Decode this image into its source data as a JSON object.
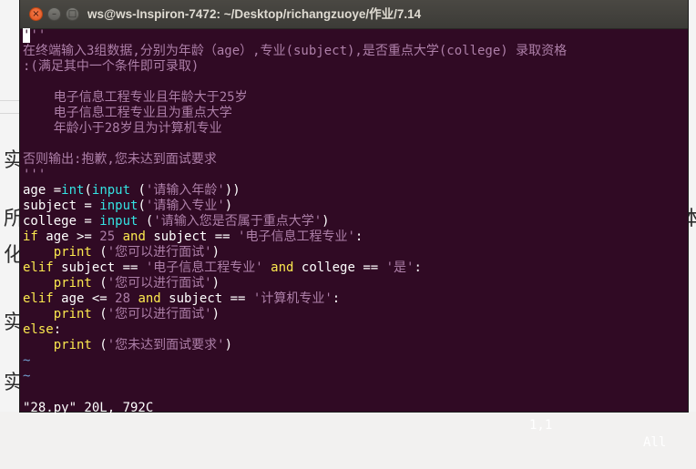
{
  "window": {
    "title": "ws@ws-Inspiron-7472: ~/Desktop/richangzuoye/作业/7.14",
    "buttons": {
      "close": "×",
      "minimize": "–",
      "maximize": "□"
    }
  },
  "background_text": [
    "实",
    "所",
    "化",
    "实",
    "实"
  ],
  "background_right_text": "本",
  "editor": {
    "lines": [
      [
        [
          "str",
          "'''"
        ]
      ],
      [
        [
          "str",
          "在终端输入3组数据,分别为年龄（age）,专业(subject),是否重点大学(college) 录取资格"
        ]
      ],
      [
        [
          "str",
          ":(满足其中一个条件即可录取)"
        ]
      ],
      [
        [
          "str",
          ""
        ]
      ],
      [
        [
          "str",
          "    电子信息工程专业且年龄大于25岁"
        ]
      ],
      [
        [
          "str",
          "    电子信息工程专业且为重点大学"
        ]
      ],
      [
        [
          "str",
          "    年龄小于28岁且为计算机专业"
        ]
      ],
      [
        [
          "str",
          ""
        ]
      ],
      [
        [
          "str",
          "否则输出:抱歉,您未达到面试要求"
        ]
      ],
      [
        [
          "str",
          "'''"
        ]
      ],
      [
        [
          "txt",
          "age ="
        ],
        [
          "bi",
          "int"
        ],
        [
          "txt",
          "("
        ],
        [
          "bi",
          "input"
        ],
        [
          "txt",
          " ("
        ],
        [
          "str",
          "'请输入年龄'"
        ],
        [
          "txt",
          "))"
        ]
      ],
      [
        [
          "txt",
          "subject = "
        ],
        [
          "bi",
          "input"
        ],
        [
          "txt",
          "("
        ],
        [
          "str",
          "'请输入专业'"
        ],
        [
          "txt",
          ")"
        ]
      ],
      [
        [
          "txt",
          "college = "
        ],
        [
          "bi",
          "input"
        ],
        [
          "txt",
          " ("
        ],
        [
          "str",
          "'请输入您是否属于重点大学'"
        ],
        [
          "txt",
          ")"
        ]
      ],
      [
        [
          "kw",
          "if"
        ],
        [
          "txt",
          " age >= "
        ],
        [
          "num",
          "25"
        ],
        [
          "txt",
          " "
        ],
        [
          "kw",
          "and"
        ],
        [
          "txt",
          " subject == "
        ],
        [
          "str",
          "'电子信息工程专业'"
        ],
        [
          "txt",
          ":"
        ]
      ],
      [
        [
          "txt",
          "    "
        ],
        [
          "kw",
          "print"
        ],
        [
          "txt",
          " ("
        ],
        [
          "str",
          "'您可以进行面试'"
        ],
        [
          "txt",
          ")"
        ]
      ],
      [
        [
          "kw",
          "elif"
        ],
        [
          "txt",
          " subject == "
        ],
        [
          "str",
          "'电子信息工程专业'"
        ],
        [
          "txt",
          " "
        ],
        [
          "kw",
          "and"
        ],
        [
          "txt",
          " college == "
        ],
        [
          "str",
          "'是'"
        ],
        [
          "txt",
          ":"
        ]
      ],
      [
        [
          "txt",
          "    "
        ],
        [
          "kw",
          "print"
        ],
        [
          "txt",
          " ("
        ],
        [
          "str",
          "'您可以进行面试'"
        ],
        [
          "txt",
          ")"
        ]
      ],
      [
        [
          "kw",
          "elif"
        ],
        [
          "txt",
          " age <= "
        ],
        [
          "num",
          "28"
        ],
        [
          "txt",
          " "
        ],
        [
          "kw",
          "and"
        ],
        [
          "txt",
          " subject == "
        ],
        [
          "str",
          "'计算机专业'"
        ],
        [
          "txt",
          ":"
        ]
      ],
      [
        [
          "txt",
          "    "
        ],
        [
          "kw",
          "print"
        ],
        [
          "txt",
          " ("
        ],
        [
          "str",
          "'您可以进行面试'"
        ],
        [
          "txt",
          ")"
        ]
      ],
      [
        [
          "kw",
          "else"
        ],
        [
          "txt",
          ":"
        ]
      ],
      [
        [
          "txt",
          "    "
        ],
        [
          "kw",
          "print"
        ],
        [
          "txt",
          " ("
        ],
        [
          "str",
          "'您未达到面试要求'"
        ],
        [
          "txt",
          ")"
        ]
      ],
      [
        [
          "tilde",
          "~"
        ]
      ],
      [
        [
          "tilde",
          "~"
        ]
      ]
    ],
    "cursor_char": "'"
  },
  "status": {
    "file": "\"28.py\" 20L, 792C",
    "position": "1,1",
    "scroll": "All"
  },
  "colors": {
    "background": "#300a24",
    "string": "#ad7fa8",
    "keyword": "#fce94f",
    "builtin": "#34e2e2",
    "tilde": "#729fcf"
  }
}
